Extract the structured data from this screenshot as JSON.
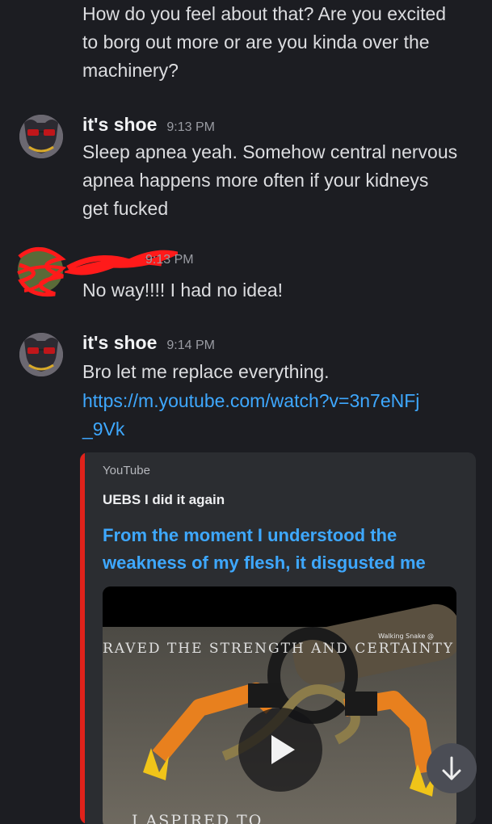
{
  "messages": [
    {
      "text": "How do you feel about that? Are you excited\nto borg out more or are you kinda over the\nmachinery?"
    },
    {
      "author": "it's shoe",
      "time": "9:13 PM",
      "text": "Sleep apnea yeah. Somehow central nervous\napnea happens more often if your kidneys\nget fucked"
    },
    {
      "time_partial": "9:13 PM",
      "text": "No way!!!! I had no idea!"
    },
    {
      "author": "it's shoe",
      "time": "9:14 PM",
      "text": "Bro let me replace everything.",
      "link": "https://m.youtube.com/watch?v=3n7eNFj\n_9Vk"
    }
  ],
  "embed": {
    "provider": "YouTube",
    "author": "UEBS I did it again",
    "title": "From the moment I understood the\nweakness of my flesh, it disgusted me",
    "thumbnail_caption_top": "RAVED THE STRENGTH AND CERTAINTY OF ST",
    "thumbnail_caption_bottom": "I ASPIRED TO",
    "thumbnail_watermark": "Walking Snake @",
    "accent_color": "#e0221b"
  },
  "icons": {
    "play": "play-icon",
    "scroll_down": "arrow-down-icon"
  },
  "colors": {
    "background": "#1c1d22",
    "link": "#3ea8ff",
    "redaction": "#ff1a1a"
  }
}
